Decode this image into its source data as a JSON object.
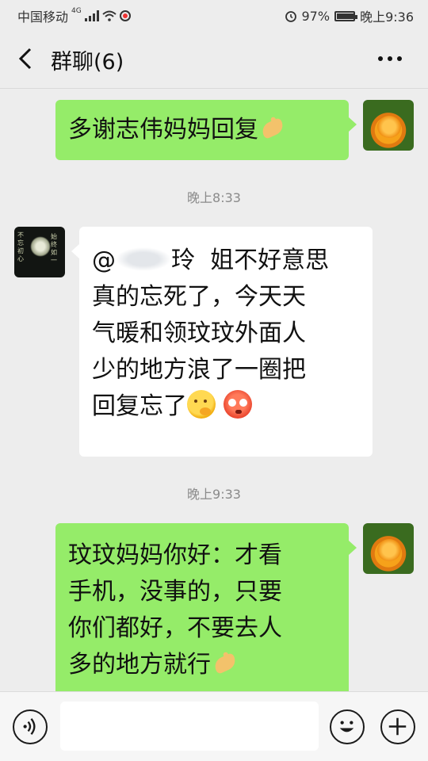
{
  "status_bar": {
    "carrier": "中国移动",
    "network_type": "4G",
    "battery_percent": "97%",
    "time": "晚上9:36",
    "icons": [
      "signal-icon",
      "wifi-icon",
      "app-notification-icon",
      "alarm-icon",
      "battery-icon"
    ]
  },
  "nav": {
    "title": "群聊(6)",
    "back_icon": "chevron-left-icon",
    "more_icon": "more-horizontal-icon"
  },
  "messages": [
    {
      "sender": "me",
      "lines": [
        "多谢志伟妈妈回复"
      ],
      "trailing_emoji": "ok-hand-emoji"
    },
    {
      "type": "timestamp",
      "text": "晚上8:33"
    },
    {
      "sender": "other",
      "avatar_text": [
        "不忘初心",
        "始终如一"
      ],
      "mention_prefix": "@",
      "mention_suffix": "玲",
      "lines": [
        "姐不好意思",
        "真的忘死了，今天天",
        "气暖和领玟玟外面人",
        "少的地方浪了一圈把",
        "回复忘了"
      ],
      "trailing_emojis": [
        "thinking-face-emoji",
        "flushed-face-emoji"
      ]
    },
    {
      "type": "timestamp",
      "text": "晚上9:33"
    },
    {
      "sender": "me",
      "lines": [
        "玟玟妈妈你好：才看",
        "手机，没事的，只要",
        "你们都好，不要去人",
        "多的地方就行"
      ],
      "trailing_emoji": "ok-hand-emoji"
    }
  ],
  "input_bar": {
    "voice_icon": "voice-icon",
    "text_value": "",
    "emoji_icon": "emoji-icon",
    "plus_icon": "plus-icon"
  },
  "colors": {
    "background": "#ededed",
    "my_bubble": "#95ec69",
    "other_bubble": "#ffffff",
    "timestamp_text": "#8a8a8a"
  }
}
